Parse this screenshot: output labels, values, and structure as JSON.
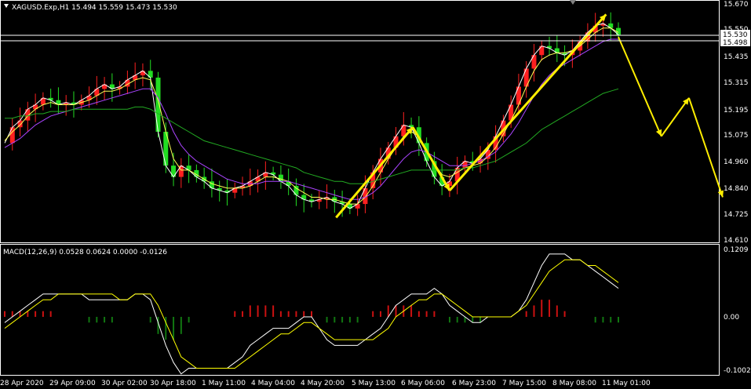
{
  "main_panel": {
    "header": "XAGUSD.Exp,H1  15.494 15.559 15.473 15.530"
  },
  "macd_panel": {
    "header": "MACD(12,26,9) 0.0528 0.0624 0.0000 -0.0126"
  },
  "price_axis": {
    "ticks": [
      "15.670",
      "15.550",
      "15.435",
      "15.315",
      "15.195",
      "15.075",
      "14.960",
      "14.840",
      "14.725",
      "14.610"
    ],
    "bid_label": "15.530",
    "ask_label": "15.498"
  },
  "macd_axis": {
    "ticks": [
      "0.1209",
      "0.00",
      "-0.1002"
    ]
  },
  "time_axis": {
    "ticks": [
      "28 Apr 2020",
      "29 Apr 09:00",
      "30 Apr 02:00",
      "30 Apr 18:00",
      "1 May 11:00",
      "4 May 04:00",
      "4 May 20:00",
      "5 May 13:00",
      "6 May 06:00",
      "6 May 23:00",
      "7 May 15:00",
      "8 May 08:00",
      "11 May 01:00"
    ]
  },
  "colors": {
    "background": "#000000",
    "bull_candle": "#ff2020",
    "bear_candle": "#22dd22",
    "ma_fast": "#ffffff",
    "ma_mid": "#ffff55",
    "ma_slow": "#aa44ff",
    "ma_long": "#22aa22",
    "macd_line": "#ffffff",
    "signal_line": "#ffff00",
    "hist_pos": "#cc1111",
    "hist_neg": "#117711",
    "arrow": "#ffee00"
  },
  "chart_data": {
    "type": "line",
    "symbol": "XAGUSD.Exp",
    "timeframe": "H1",
    "last_bar": {
      "open": 15.494,
      "high": 15.559,
      "low": 15.473,
      "close": 15.53
    },
    "ylim": [
      14.61,
      15.67
    ],
    "series": [
      {
        "values": [
          15.05,
          15.12,
          15.15,
          15.2,
          15.22,
          15.25,
          15.24,
          15.22,
          15.23,
          15.22,
          15.24,
          15.26,
          15.29,
          15.31,
          15.29,
          15.3,
          15.33,
          15.35,
          15.37,
          15.34,
          15.1,
          14.95,
          14.9,
          14.95,
          14.93,
          14.9,
          14.88,
          14.85,
          14.84,
          14.83,
          14.85,
          14.86,
          14.88,
          14.9,
          14.92,
          14.91,
          14.88,
          14.86,
          14.82,
          14.8,
          14.79,
          14.8,
          14.81,
          14.79,
          14.78,
          14.76,
          14.78,
          14.85,
          14.92,
          14.98,
          15.03,
          15.08,
          15.13,
          15.12,
          15.05,
          14.97,
          14.9,
          14.86,
          14.88,
          14.94,
          14.97,
          14.96,
          14.98,
          15.02,
          15.08,
          15.15,
          15.22,
          15.3,
          15.38,
          15.44,
          15.48,
          15.47,
          15.45,
          15.44,
          15.46,
          15.5,
          15.54,
          15.57,
          15.58,
          15.56,
          15.53
        ]
      },
      {
        "values": [
          15.06,
          15.1,
          15.13,
          15.17,
          15.2,
          15.22,
          15.23,
          15.22,
          15.22,
          15.22,
          15.23,
          15.24,
          15.26,
          15.28,
          15.28,
          15.29,
          15.31,
          15.33,
          15.34,
          15.33,
          15.24,
          15.1,
          14.98,
          14.93,
          14.93,
          14.91,
          14.89,
          14.87,
          14.86,
          14.85,
          14.85,
          14.85,
          14.86,
          14.88,
          14.9,
          14.9,
          14.89,
          14.88,
          14.85,
          14.83,
          14.81,
          14.81,
          14.8,
          14.8,
          14.79,
          14.78,
          14.78,
          14.81,
          14.86,
          14.92,
          14.98,
          15.03,
          15.08,
          15.1,
          15.08,
          15.02,
          14.96,
          14.91,
          14.9,
          14.92,
          14.94,
          14.95,
          14.96,
          14.99,
          15.03,
          15.09,
          15.15,
          15.22,
          15.3,
          15.37,
          15.42,
          15.44,
          15.45,
          15.45,
          15.46,
          15.48,
          15.51,
          15.54,
          15.56,
          15.56,
          15.54
        ]
      },
      {
        "values": [
          15.03,
          15.05,
          15.07,
          15.1,
          15.13,
          15.15,
          15.17,
          15.18,
          15.19,
          15.2,
          15.21,
          15.22,
          15.23,
          15.24,
          15.25,
          15.26,
          15.27,
          15.28,
          15.29,
          15.29,
          15.25,
          15.18,
          15.1,
          15.04,
          15.0,
          14.97,
          14.95,
          14.93,
          14.91,
          14.89,
          14.88,
          14.87,
          14.87,
          14.87,
          14.88,
          14.88,
          14.88,
          14.88,
          14.87,
          14.86,
          14.85,
          14.84,
          14.83,
          14.82,
          14.81,
          14.8,
          14.8,
          14.81,
          14.83,
          14.86,
          14.9,
          14.94,
          14.98,
          15.01,
          15.02,
          15.01,
          14.99,
          14.97,
          14.95,
          14.95,
          14.95,
          14.96,
          14.97,
          14.99,
          15.01,
          15.05,
          15.09,
          15.14,
          15.2,
          15.26,
          15.31,
          15.35,
          15.38,
          15.4,
          15.42,
          15.44,
          15.46,
          15.48,
          15.5,
          15.51,
          15.51
        ]
      },
      {
        "values": [
          15.16,
          15.16,
          15.17,
          15.17,
          15.18,
          15.18,
          15.19,
          15.19,
          15.19,
          15.2,
          15.2,
          15.2,
          15.2,
          15.2,
          15.2,
          15.2,
          15.2,
          15.21,
          15.21,
          15.2,
          15.18,
          15.16,
          15.14,
          15.12,
          15.1,
          15.08,
          15.06,
          15.05,
          15.04,
          15.03,
          15.02,
          15.01,
          15.0,
          14.99,
          14.98,
          14.97,
          14.96,
          14.95,
          14.94,
          14.92,
          14.91,
          14.9,
          14.89,
          14.88,
          14.88,
          14.87,
          14.87,
          14.87,
          14.88,
          14.89,
          14.9,
          14.91,
          14.92,
          14.93,
          14.93,
          14.93,
          14.93,
          14.93,
          14.93,
          14.93,
          14.94,
          14.94,
          14.95,
          14.96,
          14.97,
          14.99,
          15.01,
          15.03,
          15.05,
          15.08,
          15.11,
          15.13,
          15.15,
          15.17,
          15.19,
          15.21,
          15.23,
          15.25,
          15.27,
          15.28,
          15.29
        ]
      }
    ],
    "macd": {
      "ylim": [
        -0.1002,
        0.1209
      ],
      "macd_line": [
        -0.01,
        0.0,
        0.01,
        0.02,
        0.03,
        0.04,
        0.04,
        0.04,
        0.04,
        0.04,
        0.04,
        0.03,
        0.03,
        0.03,
        0.03,
        0.03,
        0.03,
        0.04,
        0.04,
        0.03,
        -0.01,
        -0.05,
        -0.08,
        -0.1,
        -0.09,
        -0.09,
        -0.09,
        -0.09,
        -0.09,
        -0.09,
        -0.08,
        -0.07,
        -0.05,
        -0.04,
        -0.03,
        -0.02,
        -0.02,
        -0.02,
        -0.01,
        0.0,
        0.0,
        -0.02,
        -0.04,
        -0.05,
        -0.05,
        -0.05,
        -0.05,
        -0.04,
        -0.03,
        -0.02,
        0.0,
        0.02,
        0.03,
        0.04,
        0.04,
        0.04,
        0.05,
        0.04,
        0.02,
        0.01,
        0.0,
        -0.01,
        -0.01,
        0.0,
        0.0,
        0.0,
        0.0,
        0.01,
        0.03,
        0.06,
        0.09,
        0.11,
        0.11,
        0.11,
        0.1,
        0.1,
        0.09,
        0.08,
        0.07,
        0.06,
        0.05
      ],
      "signal_line": [
        -0.02,
        -0.01,
        0.0,
        0.01,
        0.02,
        0.03,
        0.03,
        0.04,
        0.04,
        0.04,
        0.04,
        0.04,
        0.04,
        0.04,
        0.04,
        0.03,
        0.03,
        0.04,
        0.04,
        0.04,
        0.02,
        -0.01,
        -0.04,
        -0.07,
        -0.08,
        -0.09,
        -0.09,
        -0.09,
        -0.09,
        -0.09,
        -0.09,
        -0.08,
        -0.07,
        -0.06,
        -0.05,
        -0.04,
        -0.03,
        -0.03,
        -0.02,
        -0.01,
        -0.01,
        -0.02,
        -0.03,
        -0.04,
        -0.04,
        -0.04,
        -0.04,
        -0.04,
        -0.04,
        -0.03,
        -0.02,
        0.0,
        0.01,
        0.02,
        0.03,
        0.03,
        0.04,
        0.04,
        0.03,
        0.02,
        0.01,
        0.0,
        0.0,
        0.0,
        0.0,
        0.0,
        0.0,
        0.01,
        0.02,
        0.04,
        0.06,
        0.08,
        0.09,
        0.1,
        0.1,
        0.1,
        0.09,
        0.09,
        0.08,
        0.07,
        0.06
      ],
      "histogram": [
        0.01,
        0.01,
        0.01,
        0.01,
        0.01,
        0.01,
        0.01,
        0.0,
        0.0,
        0.0,
        0.0,
        -0.01,
        -0.01,
        -0.01,
        -0.01,
        0.0,
        0.0,
        0.0,
        0.0,
        -0.01,
        -0.03,
        -0.04,
        -0.04,
        -0.03,
        -0.01,
        0.0,
        0.0,
        0.0,
        0.0,
        0.0,
        0.01,
        0.01,
        0.02,
        0.02,
        0.02,
        0.02,
        0.01,
        0.01,
        0.01,
        0.01,
        0.01,
        0.0,
        -0.01,
        -0.01,
        -0.01,
        -0.01,
        -0.01,
        0.0,
        0.01,
        0.01,
        0.02,
        0.02,
        0.02,
        0.02,
        0.01,
        0.01,
        0.01,
        0.0,
        -0.01,
        -0.01,
        -0.01,
        -0.01,
        -0.01,
        0.0,
        0.0,
        0.0,
        0.0,
        0.0,
        0.01,
        0.02,
        0.03,
        0.03,
        0.02,
        0.01,
        0.0,
        0.0,
        0.0,
        -0.01,
        -0.01,
        -0.01,
        -0.01
      ]
    },
    "projection_arrows": [
      [
        [
          14.72,
          14.72
        ],
        [
          15.12,
          15.12
        ]
      ],
      [
        [
          15.12,
          15.12
        ],
        [
          14.84,
          14.84
        ]
      ],
      [
        [
          14.84,
          14.84
        ],
        [
          15.62,
          15.62
        ]
      ],
      [
        [
          15.52,
          15.52
        ],
        [
          15.08,
          15.08
        ]
      ],
      [
        [
          15.08,
          15.08
        ],
        [
          15.25,
          15.25
        ]
      ],
      [
        [
          15.25,
          15.25
        ],
        [
          14.81,
          14.81
        ]
      ]
    ]
  }
}
